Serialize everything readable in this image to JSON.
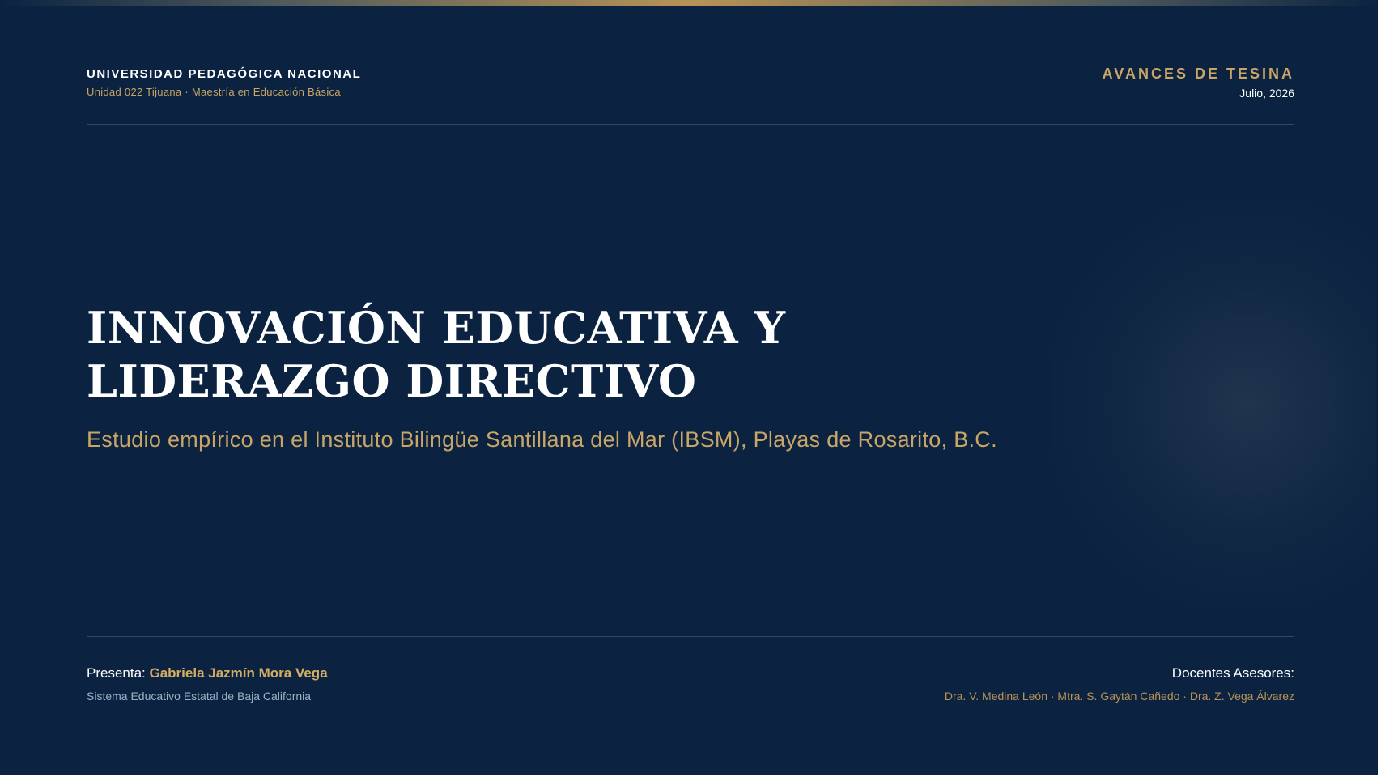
{
  "header": {
    "institution": "UNIVERSIDAD PEDAGÓGICA NACIONAL",
    "unit": "Unidad 022 Tijuana · Maestría en Educación Básica",
    "report_title": "AVANCES DE TESINA",
    "date": "Julio, 2026"
  },
  "main": {
    "title_line1": "INNOVACIÓN EDUCATIVA Y",
    "title_line2": "LIDERAZGO DIRECTIVO",
    "subtitle": "Estudio empírico en el Instituto Bilingüe Santillana del Mar (IBSM), Playas de Rosarito, B.C."
  },
  "footer": {
    "presenter_label": "Presenta: ",
    "presenter_name": "Gabriela Jazmín Mora Vega",
    "presenter_institution": "Sistema Educativo Estatal de Baja California",
    "advisors_label": "Docentes Asesores:",
    "advisors": "Dra. V. Medina León · Mtra. S. Gaytán Cañedo · Dra. Z. Vega Álvarez"
  },
  "colors": {
    "background": "#0b2341",
    "accent_gold": "#c9a566",
    "text_white": "#ffffff",
    "muted_text": "#9fb0c4"
  }
}
